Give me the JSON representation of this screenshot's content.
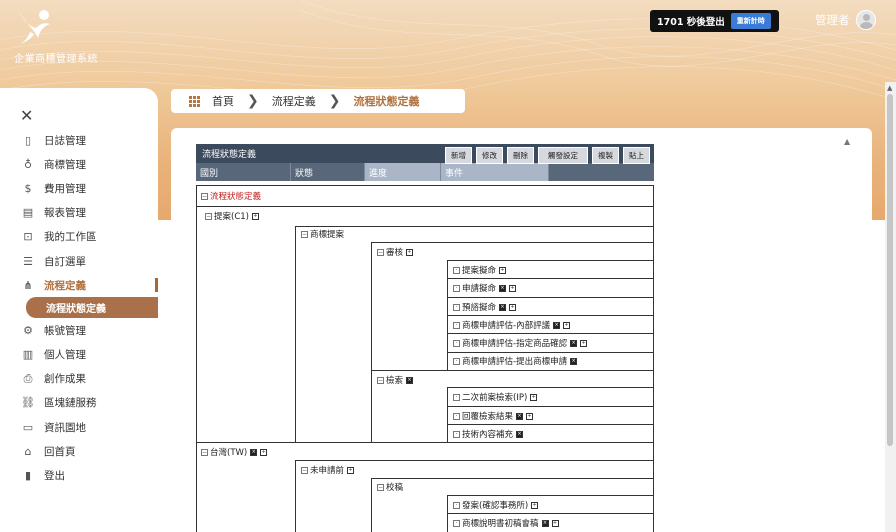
{
  "brand": {
    "name": "企業商標管理系統"
  },
  "header": {
    "timer_text": "1701 秒後登出",
    "reset_label": "重新計時",
    "user_name": "管理者"
  },
  "sidebar": {
    "items": [
      {
        "label": "日誌管理",
        "icon": "journal-icon"
      },
      {
        "label": "商標管理",
        "icon": "bulb-icon"
      },
      {
        "label": "費用管理",
        "icon": "dollar-icon"
      },
      {
        "label": "報表管理",
        "icon": "clipboard-icon"
      },
      {
        "label": "我的工作區",
        "icon": "briefcase-icon"
      },
      {
        "label": "自訂選單",
        "icon": "list-icon"
      },
      {
        "label": "流程定義",
        "icon": "sitemap-icon"
      },
      {
        "label": "流程狀態定義",
        "icon": ""
      },
      {
        "label": "帳號管理",
        "icon": "gear-icon"
      },
      {
        "label": "個人管理",
        "icon": "person-card-icon"
      },
      {
        "label": "創作成果",
        "icon": "result-icon"
      },
      {
        "label": "區塊鏈服務",
        "icon": "chain-icon"
      },
      {
        "label": "資訊園地",
        "icon": "news-icon"
      },
      {
        "label": "回首頁",
        "icon": "home-icon"
      },
      {
        "label": "登出",
        "icon": "logout-icon"
      }
    ]
  },
  "breadcrumb": {
    "home": "首頁",
    "level1": "流程定義",
    "current": "流程狀態定義"
  },
  "workflow": {
    "title": "流程狀態定義",
    "buttons": [
      "新增",
      "修改",
      "刪除",
      "觸發設定",
      "複製",
      "貼上"
    ],
    "columns": [
      "國別",
      "狀態",
      "進度",
      "事件"
    ],
    "root": "流程狀態定義",
    "nodes": {
      "c1": "提案(C1)",
      "c1_state": "商標提案",
      "review": "審核",
      "e1": "提案擬命",
      "e2": "申請擬命",
      "e3": "預諮擬命",
      "e4": "商標申請評估-內部評議",
      "e5": "商標申請評估-指定商品確認",
      "e6": "商標申請評估-提出商標申請",
      "search": "檢索",
      "e7": "二次前案檢索(IP)",
      "e8": "回覆檢索結果",
      "e9": "技術內容補充",
      "tw": "台灣(TW)",
      "tw_state": "未申請前",
      "draft": "校稿",
      "e10": "發案(確認事務所)",
      "e11": "商標說明書初稿會稿"
    }
  }
}
